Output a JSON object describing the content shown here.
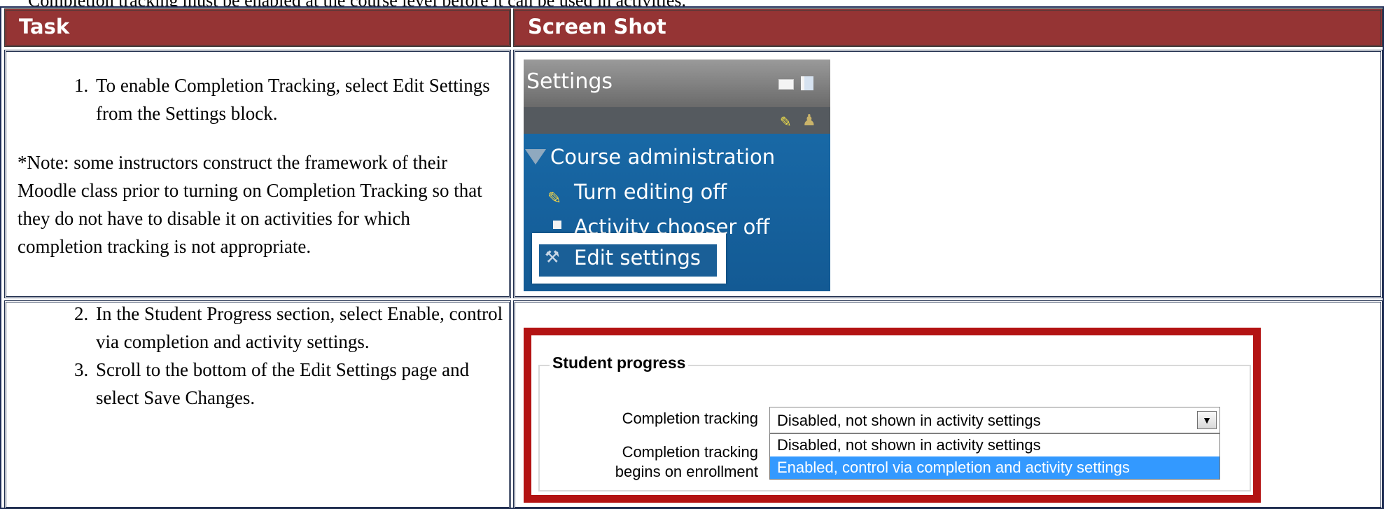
{
  "intro_text": "Completion tracking must be enabled at the course level before it can be used in activities.",
  "table": {
    "headers": [
      "Task",
      "Screen Shot"
    ],
    "row1": {
      "step1": "To enable Completion Tracking, select Edit Settings from the Settings block.",
      "note": "*Note: some instructors construct the framework of their Moodle class prior to turning on Completion Tracking so that they do not have to disable it on activities for which completion tracking is not appropriate."
    },
    "row2": {
      "step2": "In the Student Progress section, select Enable, control via completion and activity settings.",
      "step3": "Scroll to the bottom of the Edit Settings page and select Save Changes."
    }
  },
  "settings_block": {
    "title": "Settings",
    "section": "Course administration",
    "items": [
      "Turn editing off",
      "Activity chooser off",
      "Edit settings"
    ],
    "icons": [
      "minimize-icon",
      "dock-icon",
      "edit-icon",
      "assign-roles-icon",
      "collapse-triangle-icon",
      "square-icon",
      "tools-icon"
    ]
  },
  "student_progress": {
    "legend": "Student progress",
    "field1_label": "Completion tracking",
    "field2_label_line1": "Completion tracking",
    "field2_label_line2": "begins on enrollment",
    "selected_value": "Disabled, not shown in activity settings",
    "options": [
      "Disabled, not shown in activity settings",
      "Enabled, control via completion and activity settings"
    ]
  },
  "colors": {
    "header_bg": "#953434",
    "frame_red": "#b31313",
    "settings_blue": "#1b6fae",
    "highlight_blue": "#3399ff"
  }
}
